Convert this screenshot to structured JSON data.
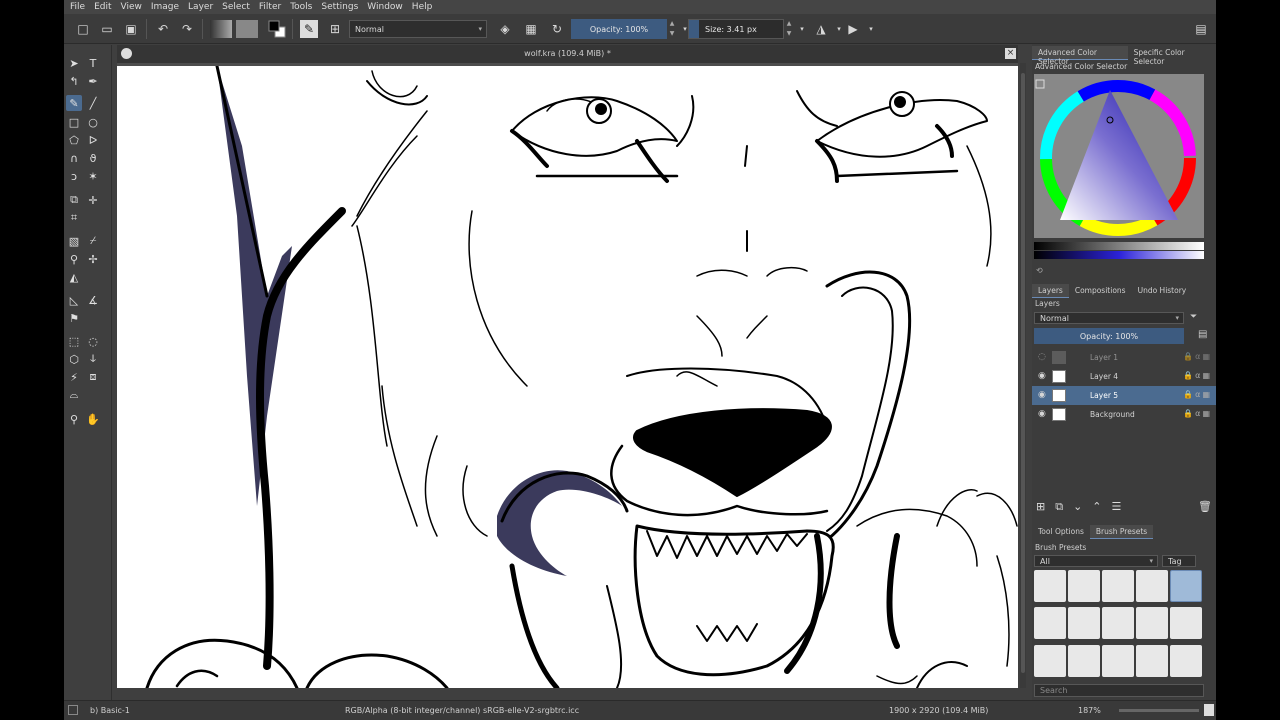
{
  "menu": [
    "File",
    "Edit",
    "View",
    "Image",
    "Layer",
    "Select",
    "Filter",
    "Tools",
    "Settings",
    "Window",
    "Help"
  ],
  "toolbar": {
    "blend_mode": "Normal",
    "opacity": "Opacity: 100%",
    "size": "Size: 3.41 px"
  },
  "document": {
    "title": "wolf.kra (109.4 MiB) *",
    "close": "×"
  },
  "dockers": {
    "color_tabs": [
      "Advanced Color Selector",
      "Specific Color Selector"
    ],
    "color_title": "Advanced Color Selector",
    "layer_tabs": [
      "Layers",
      "Compositions",
      "Undo History"
    ],
    "layers_title": "Layers",
    "layer_blend": "Normal",
    "layer_opacity": "Opacity:  100%",
    "layers": [
      {
        "name": "Layer 1"
      },
      {
        "name": "Layer 4"
      },
      {
        "name": "Layer 5"
      },
      {
        "name": "Background"
      }
    ],
    "bottom_tabs": [
      "Tool Options",
      "Brush Presets"
    ],
    "presets_title": "Brush Presets",
    "presets_filter": "All",
    "presets_tag": "Tag",
    "search_placeholder": "Search"
  },
  "status": {
    "brush": "b) Basic-1",
    "colorspace": "RGB/Alpha (8-bit integer/channel)  sRGB-elle-V2-srgbtrc.icc",
    "dimensions": "1900 x 2920 (109.4 MiB)",
    "zoom": "187%"
  }
}
